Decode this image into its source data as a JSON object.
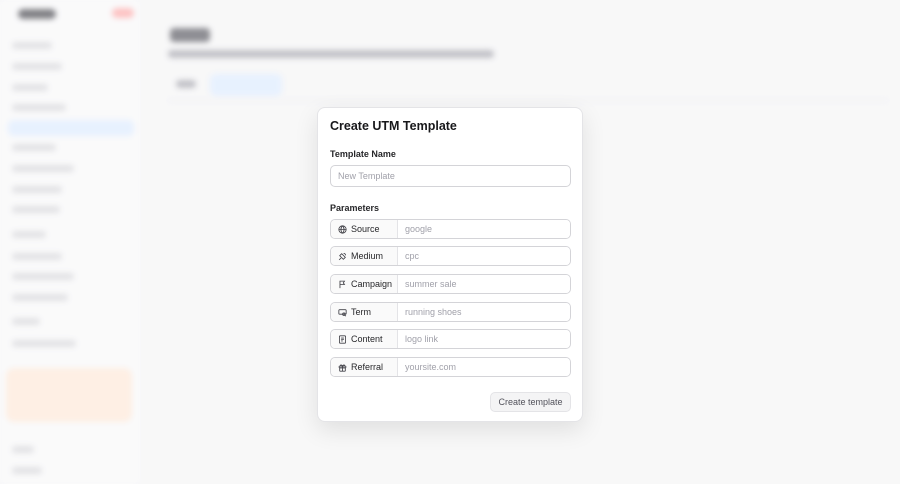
{
  "modal": {
    "title": "Create UTM Template",
    "template_name_label": "Template Name",
    "template_name_placeholder": "New Template",
    "parameters_label": "Parameters",
    "parameters": [
      {
        "label": "Source",
        "icon": "globe-icon",
        "placeholder": "google"
      },
      {
        "label": "Medium",
        "icon": "satellite-icon",
        "placeholder": "cpc"
      },
      {
        "label": "Campaign",
        "icon": "flag-icon",
        "placeholder": "summer sale"
      },
      {
        "label": "Term",
        "icon": "search-term-icon",
        "placeholder": "running shoes"
      },
      {
        "label": "Content",
        "icon": "document-icon",
        "placeholder": "logo link"
      },
      {
        "label": "Referral",
        "icon": "gift-icon",
        "placeholder": "yoursite.com"
      }
    ],
    "submit_label": "Create template"
  }
}
